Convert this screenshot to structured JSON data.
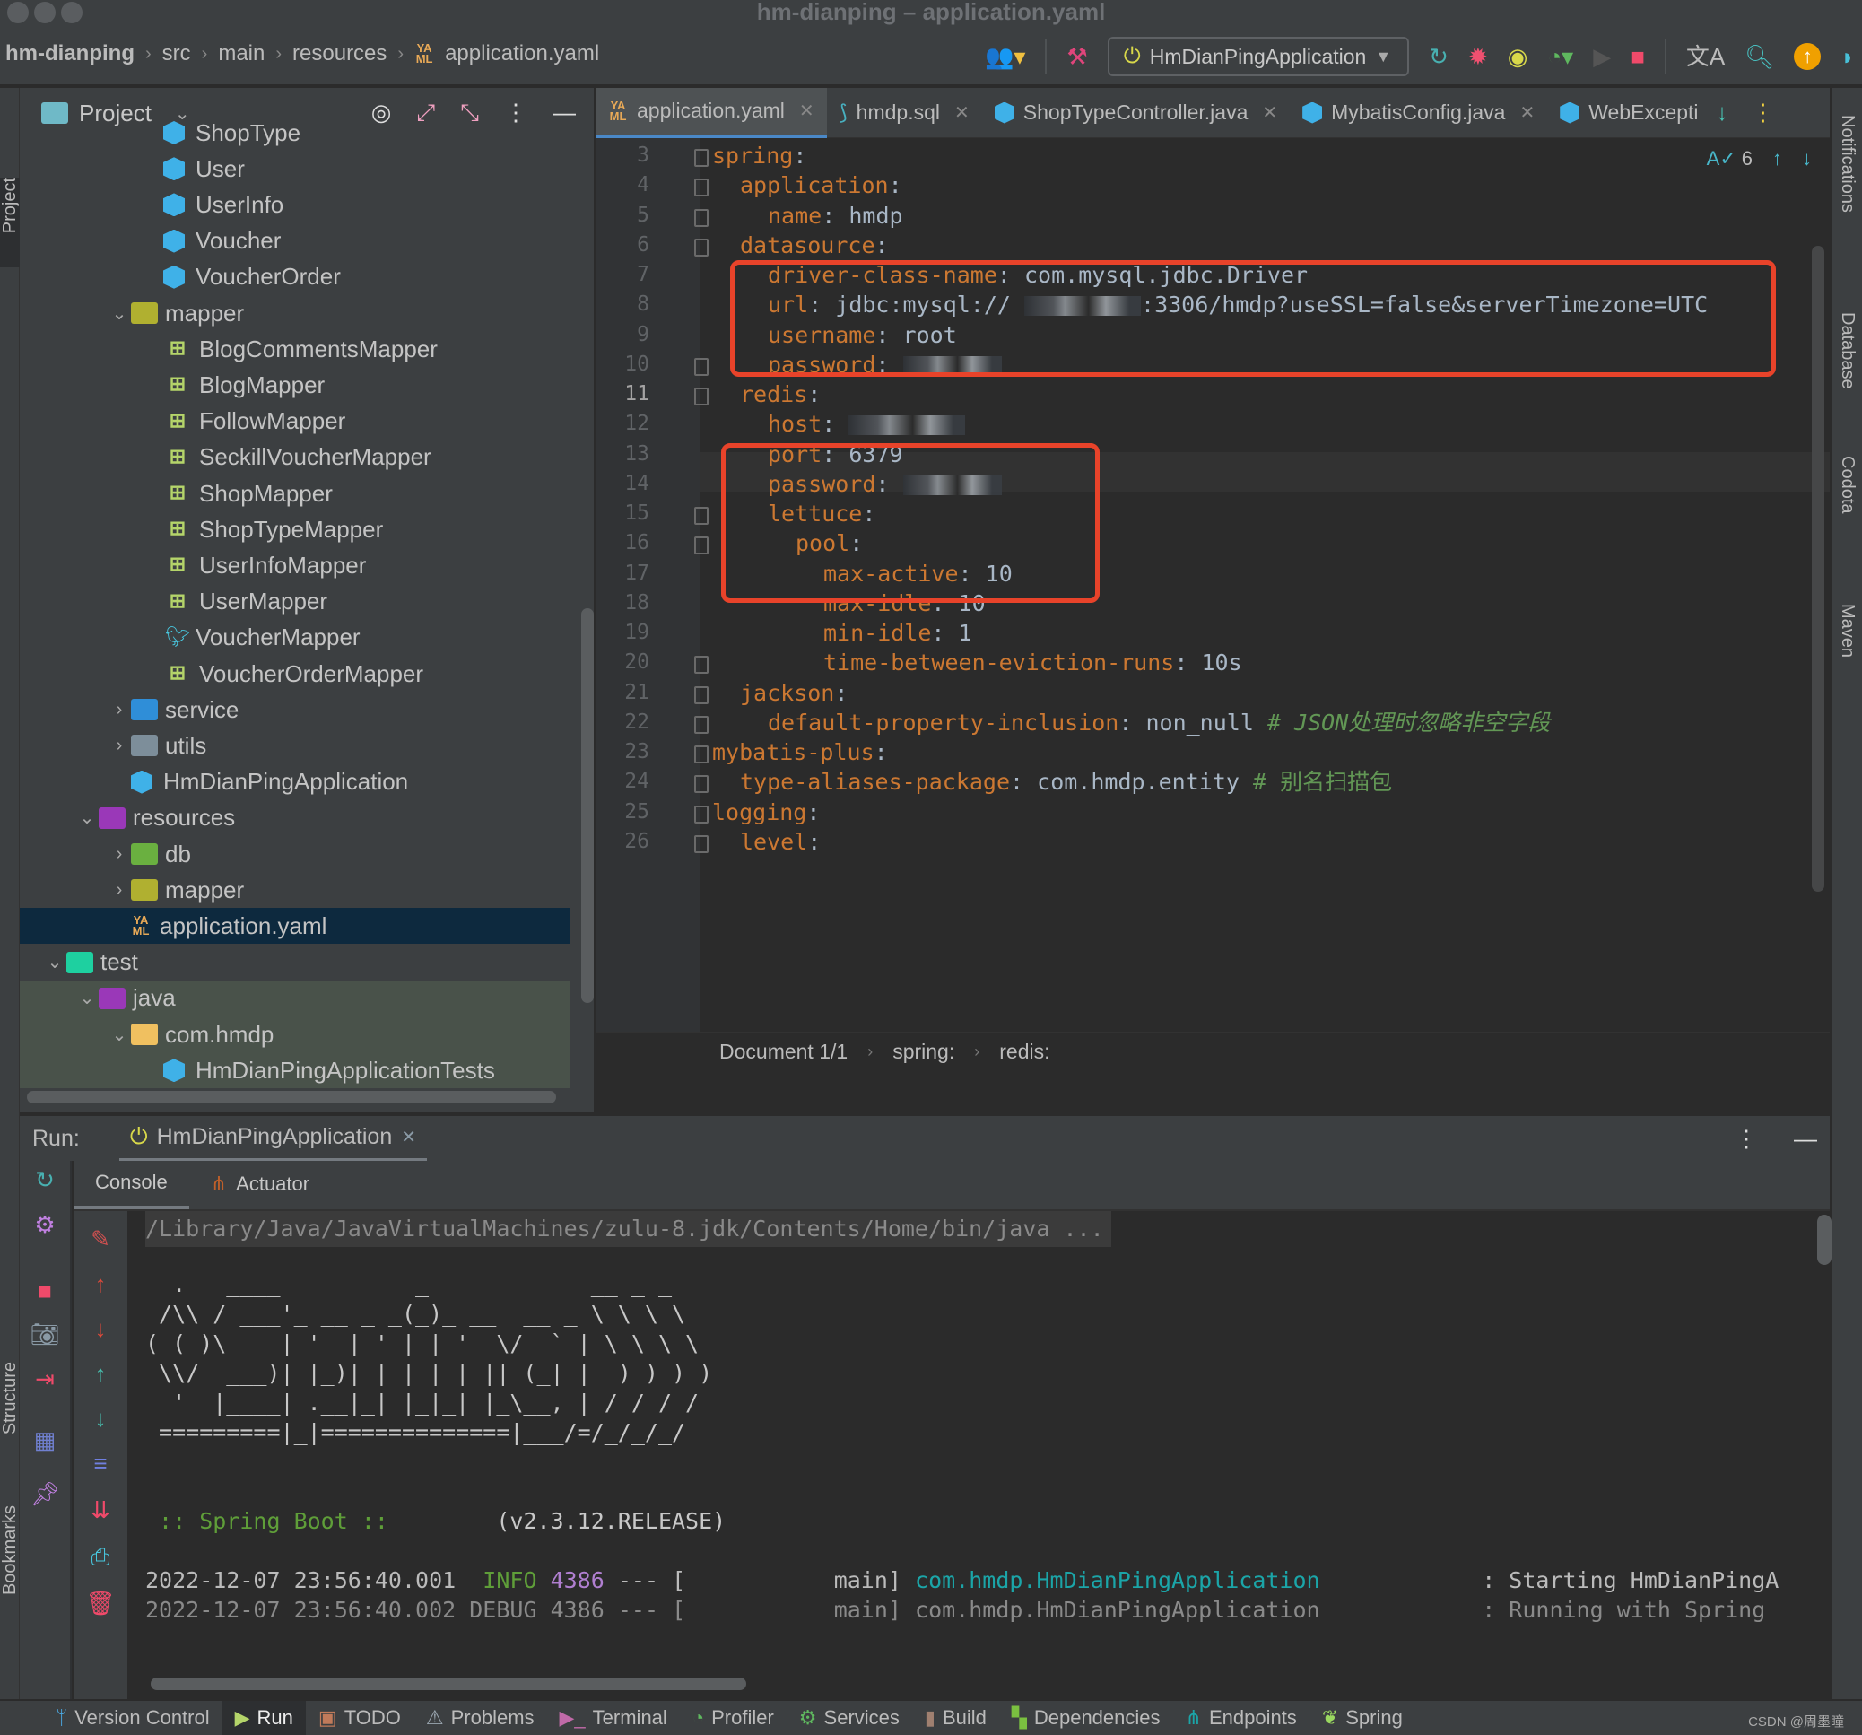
{
  "window": {
    "title": "hm-dianping – application.yaml"
  },
  "breadcrumb": [
    "hm-dianping",
    "src",
    "main",
    "resources",
    "application.yaml"
  ],
  "toolbar": {
    "run_config": "HmDianPingApplication",
    "icons": [
      "vcs-users-icon",
      "build-hammer-icon",
      "rerun-icon",
      "debug-icon",
      "run-with-coverage-icon",
      "profiler-icon",
      "run-icon",
      "stop-icon",
      "translate-icon",
      "search-icon",
      "update-icon",
      "plugin-icon"
    ]
  },
  "project_panel": {
    "title": "Project",
    "tree": [
      {
        "label": "ShopType",
        "type": "class",
        "depth": 4
      },
      {
        "label": "User",
        "type": "class",
        "depth": 4
      },
      {
        "label": "UserInfo",
        "type": "class",
        "depth": 4
      },
      {
        "label": "Voucher",
        "type": "class",
        "depth": 4
      },
      {
        "label": "VoucherOrder",
        "type": "class",
        "depth": 4
      },
      {
        "label": "mapper",
        "type": "folder",
        "depth": 3,
        "expanded": true
      },
      {
        "label": "BlogCommentsMapper",
        "type": "mapper",
        "depth": 4
      },
      {
        "label": "BlogMapper",
        "type": "mapper",
        "depth": 4
      },
      {
        "label": "FollowMapper",
        "type": "mapper",
        "depth": 4
      },
      {
        "label": "SeckillVoucherMapper",
        "type": "mapper",
        "depth": 4
      },
      {
        "label": "ShopMapper",
        "type": "mapper",
        "depth": 4
      },
      {
        "label": "ShopTypeMapper",
        "type": "mapper",
        "depth": 4
      },
      {
        "label": "UserInfoMapper",
        "type": "mapper",
        "depth": 4
      },
      {
        "label": "UserMapper",
        "type": "mapper",
        "depth": 4
      },
      {
        "label": "VoucherMapper",
        "type": "mybatis",
        "depth": 4
      },
      {
        "label": "VoucherOrderMapper",
        "type": "mapper",
        "depth": 4
      },
      {
        "label": "service",
        "type": "folder",
        "depth": 3,
        "expanded": false
      },
      {
        "label": "utils",
        "type": "folder",
        "depth": 3,
        "expanded": false
      },
      {
        "label": "HmDianPingApplication",
        "type": "springapp",
        "depth": 3
      },
      {
        "label": "resources",
        "type": "folder",
        "depth": 2,
        "expanded": true
      },
      {
        "label": "db",
        "type": "folder",
        "depth": 3,
        "expanded": false
      },
      {
        "label": "mapper",
        "type": "folder",
        "depth": 3,
        "expanded": false
      },
      {
        "label": "application.yaml",
        "type": "yaml",
        "depth": 3,
        "selected": true
      },
      {
        "label": "test",
        "type": "folder",
        "depth": 1,
        "expanded": true
      },
      {
        "label": "java",
        "type": "folder",
        "depth": 2,
        "expanded": true
      },
      {
        "label": "com.hmdp",
        "type": "folder",
        "depth": 3,
        "expanded": true
      },
      {
        "label": "HmDianPingApplicationTests",
        "type": "class",
        "depth": 4
      }
    ]
  },
  "editor_tabs": [
    {
      "label": "application.yaml",
      "icon": "yaml-icon",
      "active": true,
      "closable": true
    },
    {
      "label": "hmdp.sql",
      "icon": "mysql-icon",
      "active": false,
      "closable": true
    },
    {
      "label": "ShopTypeController.java",
      "icon": "class-icon",
      "active": false,
      "closable": true
    },
    {
      "label": "MybatisConfig.java",
      "icon": "class-icon",
      "active": false,
      "closable": true
    },
    {
      "label": "WebExcepti",
      "icon": "class-icon",
      "active": false,
      "closable": false
    }
  ],
  "editor": {
    "inspection_count": "6",
    "current_line": 11,
    "lines": [
      {
        "n": 3,
        "indent": 0,
        "key": "spring",
        "value": ""
      },
      {
        "n": 4,
        "indent": 1,
        "key": "application",
        "value": ""
      },
      {
        "n": 5,
        "indent": 2,
        "key": "name",
        "value": "hmdp"
      },
      {
        "n": 6,
        "indent": 1,
        "key": "datasource",
        "value": ""
      },
      {
        "n": 7,
        "indent": 2,
        "key": "driver-class-name",
        "value": "com.mysql.jdbc.Driver"
      },
      {
        "n": 8,
        "indent": 2,
        "key": "url",
        "value": "jdbc:mysql://",
        "redacted": true,
        "value_after": ":3306/hmdp?useSSL=false&serverTimezone=UTC"
      },
      {
        "n": 9,
        "indent": 2,
        "key": "username",
        "value": "root"
      },
      {
        "n": 10,
        "indent": 2,
        "key": "password",
        "value": "",
        "redacted": true
      },
      {
        "n": 11,
        "indent": 1,
        "key": "redis",
        "value": ""
      },
      {
        "n": 12,
        "indent": 2,
        "key": "host",
        "value": "",
        "redacted": true
      },
      {
        "n": 13,
        "indent": 2,
        "key": "port",
        "value": "6379"
      },
      {
        "n": 14,
        "indent": 2,
        "key": "password",
        "value": "",
        "redacted": true
      },
      {
        "n": 15,
        "indent": 2,
        "key": "lettuce",
        "value": ""
      },
      {
        "n": 16,
        "indent": 3,
        "key": "pool",
        "value": ""
      },
      {
        "n": 17,
        "indent": 4,
        "key": "max-active",
        "value": "10"
      },
      {
        "n": 18,
        "indent": 4,
        "key": "max-idle",
        "value": "10"
      },
      {
        "n": 19,
        "indent": 4,
        "key": "min-idle",
        "value": "1"
      },
      {
        "n": 20,
        "indent": 4,
        "key": "time-between-eviction-runs",
        "value": "10s"
      },
      {
        "n": 21,
        "indent": 1,
        "key": "jackson",
        "value": ""
      },
      {
        "n": 22,
        "indent": 2,
        "key": "default-property-inclusion",
        "value": "non_null",
        "comment": "# JSON处理时忽略非空字段"
      },
      {
        "n": 23,
        "indent": 0,
        "key": "mybatis-plus",
        "value": ""
      },
      {
        "n": 24,
        "indent": 1,
        "key": "type-aliases-package",
        "value": "com.hmdp.entity",
        "comment": "# 别名扫描包"
      },
      {
        "n": 25,
        "indent": 0,
        "key": "logging",
        "value": ""
      },
      {
        "n": 26,
        "indent": 1,
        "key": "level",
        "value": ""
      }
    ],
    "breadcrumb": [
      "Document 1/1",
      "spring:",
      "redis:"
    ]
  },
  "right_stripe": [
    "Notifications",
    "Database",
    "Codota",
    "Maven"
  ],
  "left_stripe": [
    "Project",
    "Structure",
    "Bookmarks"
  ],
  "run_panel": {
    "label": "Run:",
    "tab": "HmDianPingApplication",
    "console_tabs": [
      "Console",
      "Actuator"
    ],
    "command": "/Library/Java/JavaVirtualMachines/zulu-8.jdk/Contents/Home/bin/java ...",
    "banner": [
      "  .   ____          _            __ _ _",
      " /\\\\ / ___'_ __ _ _(_)_ __  __ _ \\ \\ \\ \\",
      "( ( )\\___ | '_ | '_| | '_ \\/ _` | \\ \\ \\ \\",
      " \\\\/  ___)| |_)| | | | | || (_| |  ) ) ) )",
      "  '  |____| .__|_| |_|_| |_\\__, | / / / /",
      " =========|_|==============|___/=/_/_/_/"
    ],
    "spring_boot_label": " :: Spring Boot :: ",
    "spring_boot_version": "       (v2.3.12.RELEASE)",
    "log_lines": [
      {
        "timestamp": "2022-12-07 23:56:40.001",
        "level": "INFO",
        "pid": "4386",
        "sep": "--- [",
        "thread": "main]",
        "logger": "com.hmdp.HmDianPingApplication",
        "message": ": Starting HmDianPingA"
      },
      {
        "timestamp": "2022-12-07 23:56:40.002",
        "level": "DEBUG",
        "pid": "4386",
        "sep": "--- [",
        "thread": "main]",
        "logger": "com.hmdp.HmDianPingApplication",
        "message": ": Running with Spring"
      }
    ]
  },
  "statusbar": {
    "items": [
      "Version Control",
      "Run",
      "TODO",
      "Problems",
      "Terminal",
      "Profiler",
      "Services",
      "Build",
      "Dependencies",
      "Endpoints",
      "Spring"
    ],
    "active": "Run",
    "watermark": "CSDN @周墨瞳"
  }
}
